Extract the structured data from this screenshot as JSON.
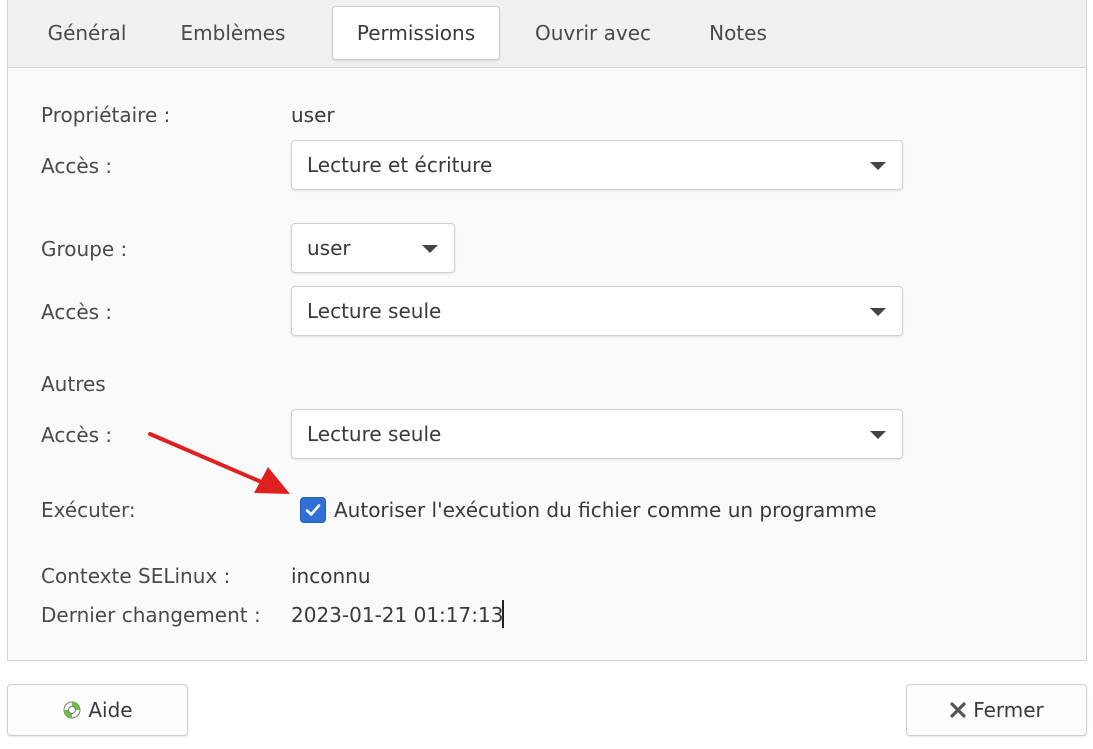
{
  "tabs": [
    {
      "label": "Général"
    },
    {
      "label": "Emblèmes"
    },
    {
      "label": "Permissions"
    },
    {
      "label": "Ouvrir avec"
    },
    {
      "label": "Notes"
    }
  ],
  "active_tab": "Permissions",
  "owner": {
    "label": "Propriétaire :",
    "value": "user",
    "access_label": "Accès :",
    "access_value": "Lecture et écriture"
  },
  "group": {
    "label": "Groupe :",
    "value": "user",
    "access_label": "Accès :",
    "access_value": "Lecture seule"
  },
  "others": {
    "label": "Autres",
    "access_label": "Accès :",
    "access_value": "Lecture seule"
  },
  "execute": {
    "label": "Exécuter:",
    "checked": true,
    "checkbox_label": "Autoriser l'exécution du fichier comme un programme"
  },
  "selinux": {
    "label": "Contexte SELinux :",
    "value": "inconnu"
  },
  "last_change": {
    "label": "Dernier changement :",
    "value": "2023-01-21 01:17:13"
  },
  "buttons": {
    "help_label": "Aide",
    "close_label": "Fermer"
  },
  "icons": {
    "help": "lifebuoy-icon",
    "close": "close-x-icon",
    "dropdown": "chevron-down-icon",
    "check": "checkmark-icon"
  },
  "colors": {
    "checkbox": "#2f6fd6",
    "annotation_arrow": "#e02020"
  }
}
